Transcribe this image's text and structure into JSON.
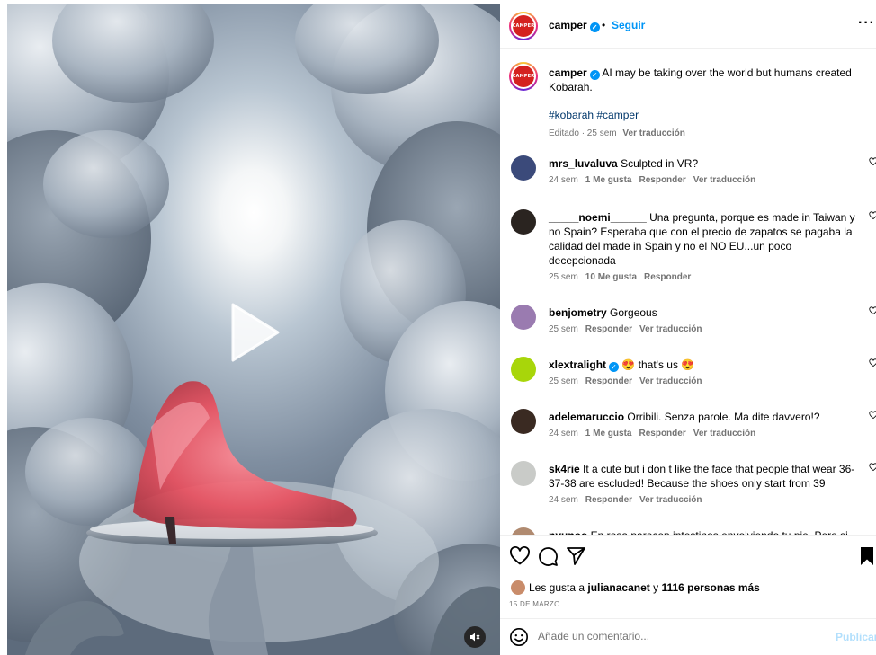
{
  "post": {
    "author": "camper",
    "author_logo_text": "CAMPER",
    "separator": "•",
    "follow_label": "Seguir",
    "more_label": "···",
    "caption_text": "AI may be taking over the world but humans created Kobarah.",
    "hashtags": "#kobarah #camper",
    "caption_meta": "Editado · 25 sem",
    "caption_translate": "Ver traducción"
  },
  "comments": [
    {
      "user": "mrs_luvaluva",
      "text": "Sculpted in VR?",
      "time": "24 sem",
      "likes": "1 Me gusta",
      "reply": "Responder",
      "translate": "Ver traducción",
      "avatar_color": "#3b4a7a"
    },
    {
      "user": "_____noemi______",
      "text": "Una pregunta, porque es made in Taiwan y no Spain? Esperaba que con el precio de zapatos se pagaba la calidad del made in Spain y no el NO EU...un poco decepcionada",
      "time": "25 sem",
      "likes": "10 Me gusta",
      "reply": "Responder",
      "translate": "",
      "avatar_color": "#2a2420"
    },
    {
      "user": "benjometry",
      "text": "Gorgeous",
      "time": "25 sem",
      "likes": "",
      "reply": "Responder",
      "translate": "Ver traducción",
      "avatar_color": "#9a7bb0"
    },
    {
      "user": "xlextralight",
      "text": "😍 that's us 😍",
      "time": "25 sem",
      "likes": "",
      "reply": "Responder",
      "translate": "Ver traducción",
      "avatar_color": "#a8d60a"
    },
    {
      "user": "adelemaruccio",
      "text": "Orribili. Senza parole. Ma dite davvero!?",
      "time": "24 sem",
      "likes": "1 Me gusta",
      "reply": "Responder",
      "translate": "Ver traducción",
      "avatar_color": "#3a2a22"
    },
    {
      "user": "sk4rie",
      "text": "It a cute but i don t like the face that people that wear 36-37-38 are escluded! Because the shoes only start from 39",
      "time": "24 sem",
      "likes": "",
      "reply": "Responder",
      "translate": "Ver traducción",
      "avatar_color": "#c9cbc8"
    },
    {
      "user": "nyunoo",
      "text": "En rosa parecen intestinos envolviendo tu pie. Pero si",
      "time": "",
      "likes": "",
      "reply": "",
      "translate": "",
      "avatar_color": "#b08a70"
    }
  ],
  "likes_summary": {
    "prefix": "Les gusta a",
    "first_user": "julianacanet",
    "connector": "y",
    "others": "1116 personas más"
  },
  "date_label": "15 DE MARZO",
  "comment_box": {
    "placeholder": "Añade un comentario...",
    "publish_label": "Publicar"
  },
  "icons": {
    "like": "heart-icon",
    "comment": "comment-icon",
    "share": "send-icon",
    "save": "bookmark-icon",
    "emoji": "emoji-icon",
    "play": "play-icon",
    "mute": "speaker-muted-icon"
  },
  "colors": {
    "link_blue": "#0095f6",
    "hashtag": "#00376b",
    "muted_text": "#737373",
    "publish_disabled": "#b2dffc",
    "brand_red": "#d4221f"
  }
}
